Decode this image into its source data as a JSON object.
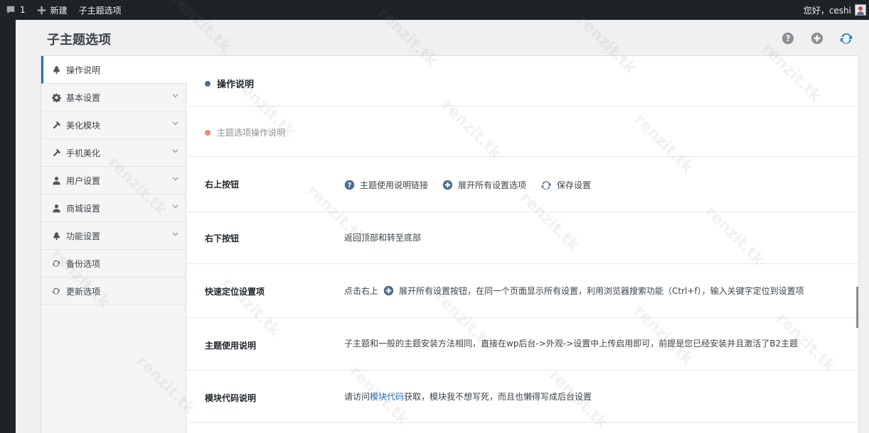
{
  "adminbar": {
    "comments_count": "1",
    "new_label": "新建",
    "page_link": "子主题选项",
    "greeting": "您好，ceshi"
  },
  "page": {
    "title": "子主题选项"
  },
  "sidebar": {
    "items": [
      {
        "label": "操作说明",
        "icon": "tree-icon",
        "active": true,
        "has_children": false
      },
      {
        "label": "基本设置",
        "icon": "gear-icon",
        "active": false,
        "has_children": true
      },
      {
        "label": "美化模块",
        "icon": "hammer-icon",
        "active": false,
        "has_children": true
      },
      {
        "label": "手机美化",
        "icon": "hammer-icon",
        "active": false,
        "has_children": true
      },
      {
        "label": "用户设置",
        "icon": "user-icon",
        "active": false,
        "has_children": true
      },
      {
        "label": "商城设置",
        "icon": "user-icon",
        "active": false,
        "has_children": true
      },
      {
        "label": "功能设置",
        "icon": "tree-icon",
        "active": false,
        "has_children": true
      },
      {
        "label": "备份选项",
        "icon": "refresh-icon",
        "active": false,
        "has_children": false
      },
      {
        "label": "更新选项",
        "icon": "refresh-icon",
        "active": false,
        "has_children": false
      }
    ]
  },
  "content": {
    "section_title": "操作说明",
    "section_note": "主题选项操作说明",
    "rows": [
      {
        "label": "右上按钮",
        "buttons": [
          "主题使用说明链接",
          "展开所有设置选项",
          "保存设置"
        ]
      },
      {
        "label": "右下按钮",
        "value": "返回顶部和转至底部"
      },
      {
        "label": "快速定位设置项",
        "value_prefix": "点击右上",
        "value_suffix": "展开所有设置按钮，在同一个页面显示所有设置，利用浏览器搜索功能（Ctrl+f），输入关键字定位到设置项"
      },
      {
        "label": "主题使用说明",
        "value": "子主题和一般的主题安装方法相同，直接在wp后台->外观->设置中上传启用即可，前提是您已经安装并且激活了B2主题"
      },
      {
        "label": "模块代码说明",
        "value_prefix": "请访问",
        "link": "模块代码",
        "value_suffix": "获取，模块我不想写死，而且也懒得写成后台设置"
      }
    ]
  },
  "watermark": "renzit.tk",
  "colors": {
    "adminbar_bg": "#1d2327",
    "accent": "#2271b1",
    "section_dot": "#4f6d8f",
    "note_dot": "#f0886a",
    "icon_grey": "#72777c"
  }
}
